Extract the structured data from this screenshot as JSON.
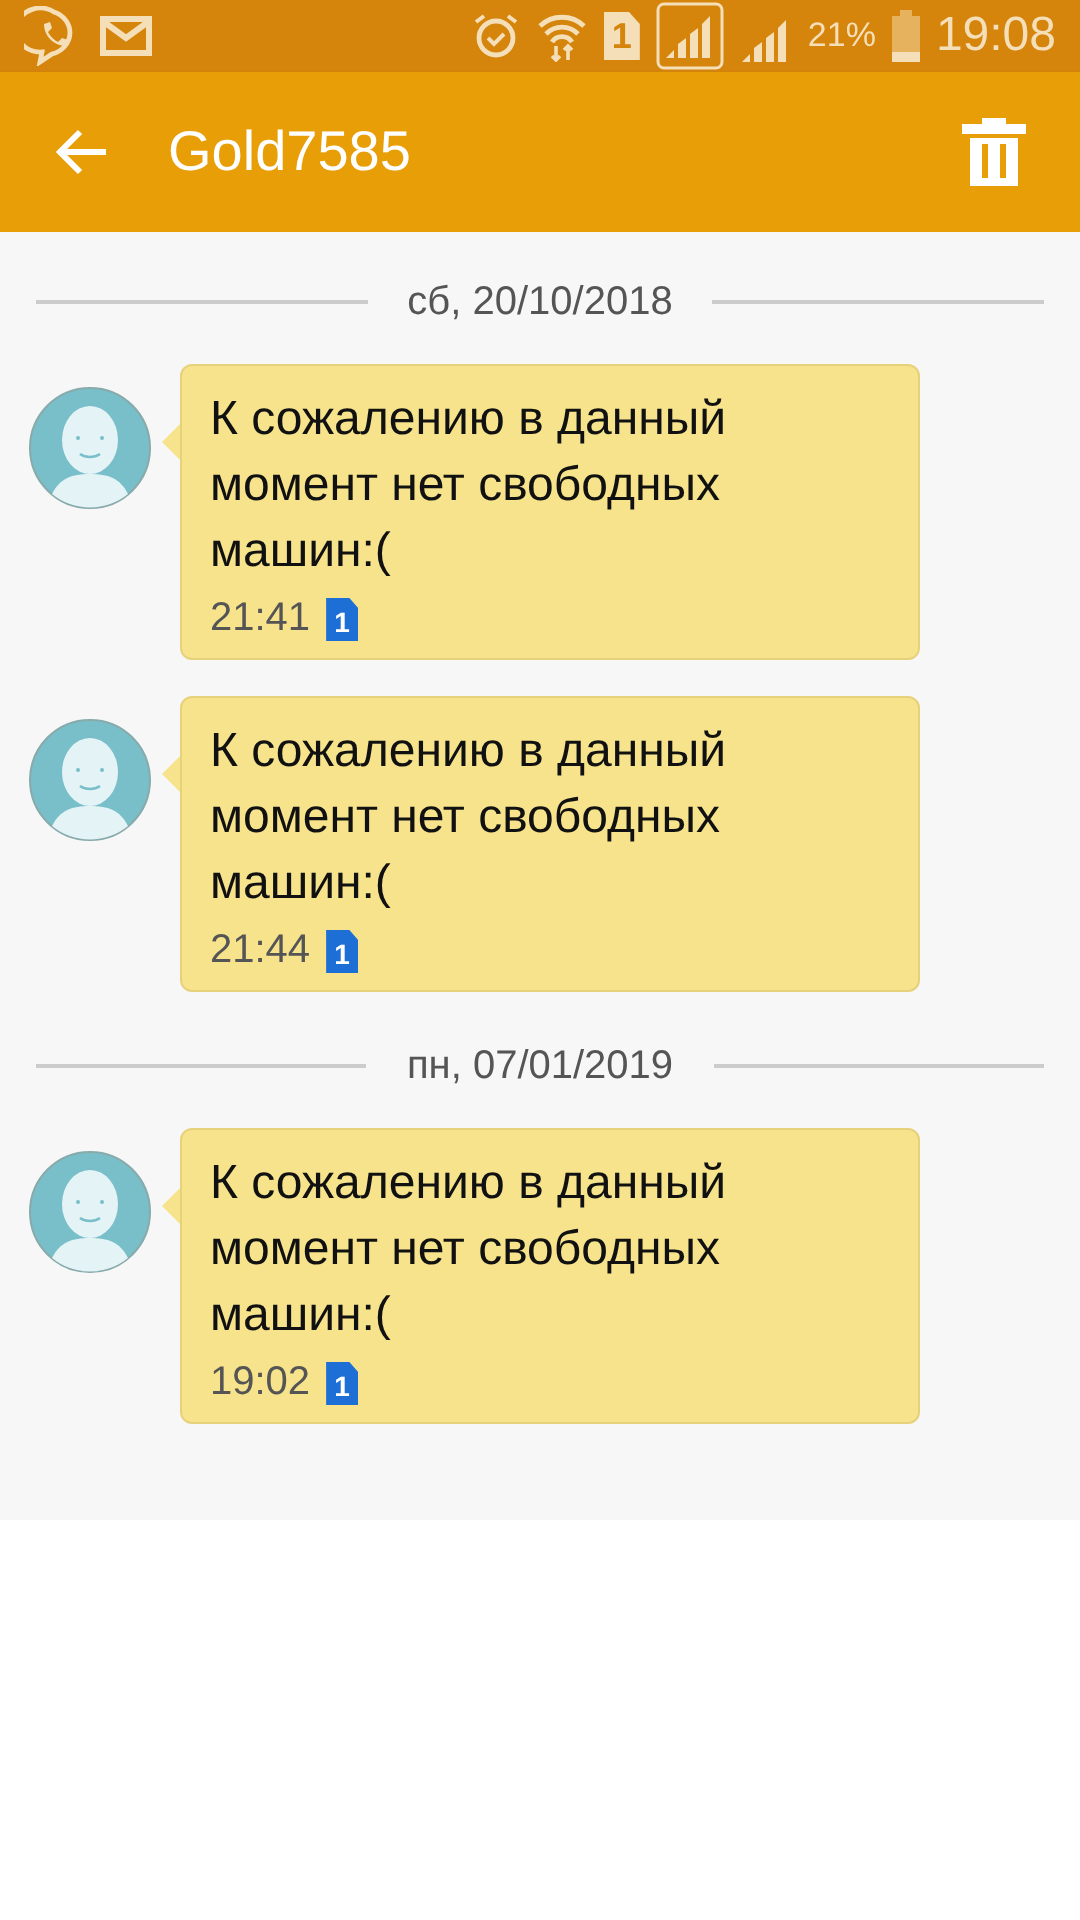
{
  "status_bar": {
    "sim_label": "1",
    "battery": "21%",
    "time": "19:08"
  },
  "app_bar": {
    "title": "Gold7585"
  },
  "groups": [
    {
      "date": "сб, 20/10/2018",
      "messages": [
        {
          "text": "К сожалению в данный момент нет свободных машин:(",
          "time": "21:41",
          "sim": "1"
        },
        {
          "text": "К сожалению в данный момент нет свободных машин:(",
          "time": "21:44",
          "sim": "1"
        }
      ]
    },
    {
      "date": "пн, 07/01/2019",
      "messages": [
        {
          "text": "К сожалению в данный момент нет свободных машин:(",
          "time": "19:02",
          "sim": "1"
        }
      ]
    }
  ]
}
